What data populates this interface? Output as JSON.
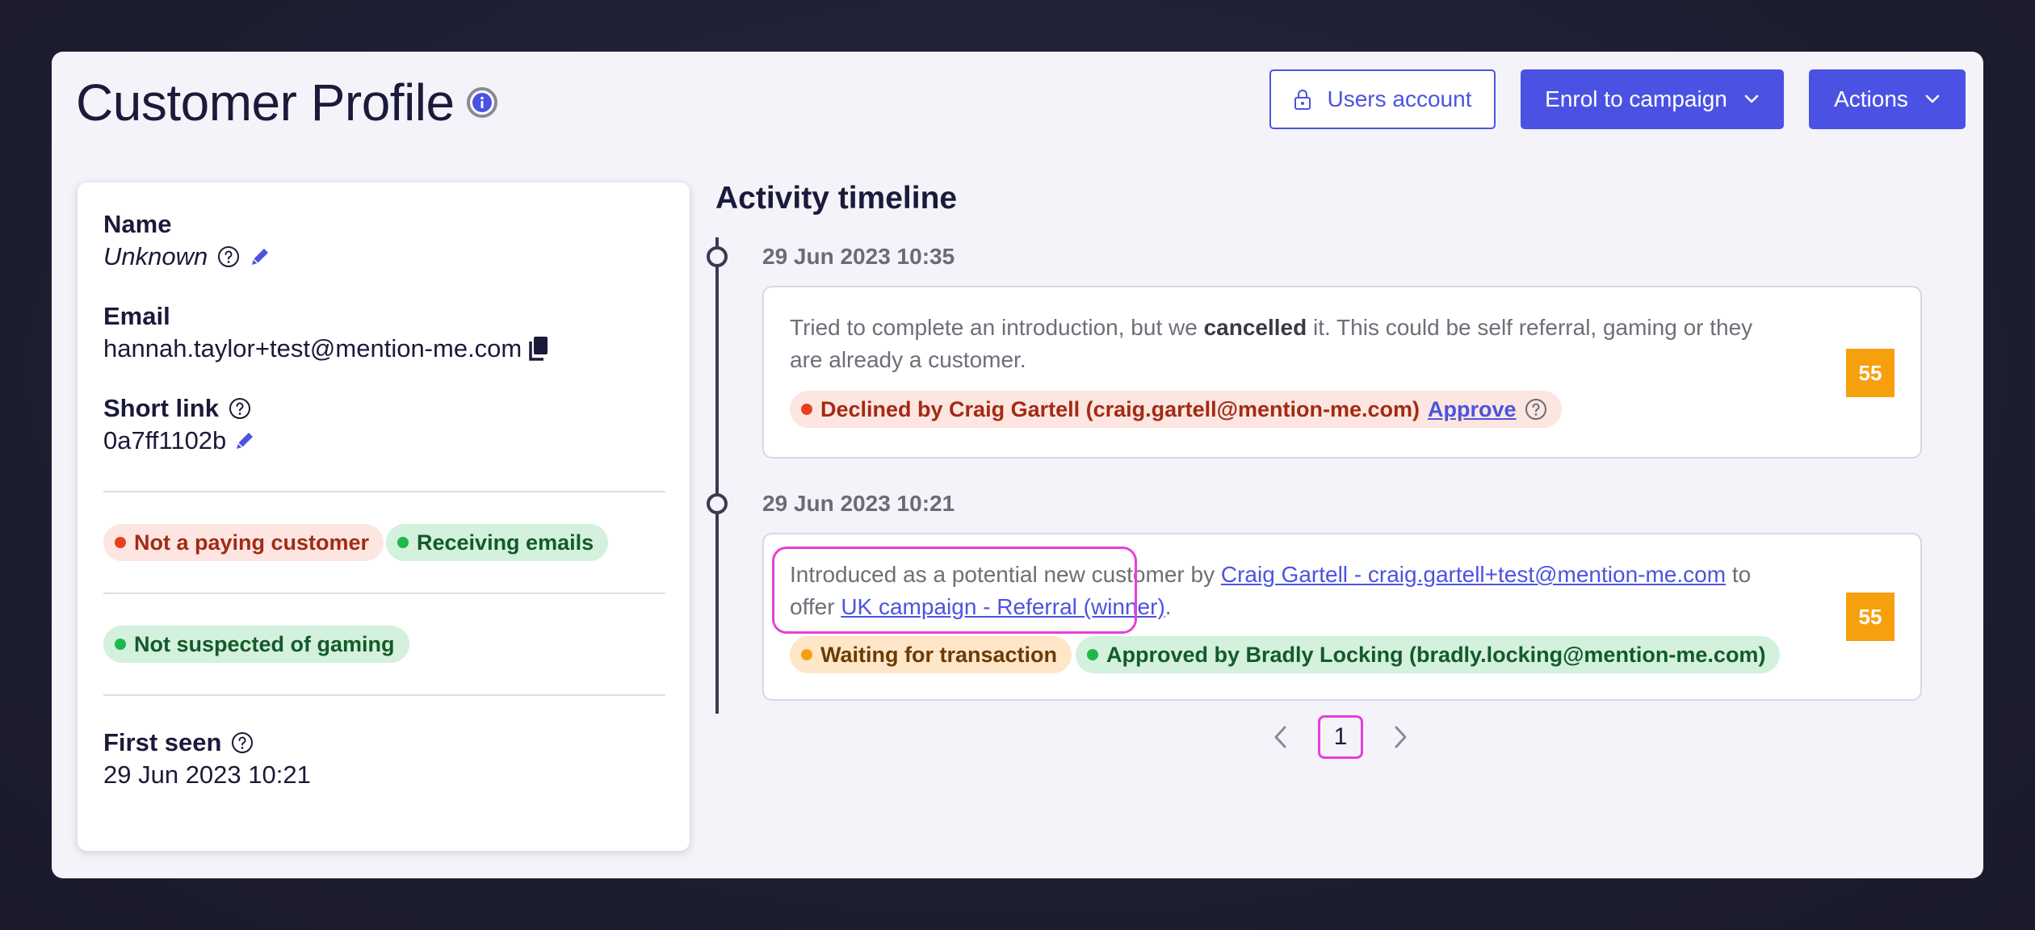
{
  "header": {
    "title": "Customer Profile",
    "users_account": "Users account",
    "enrol_campaign": "Enrol to campaign",
    "actions": "Actions"
  },
  "profile": {
    "name_label": "Name",
    "name_value": "Unknown",
    "email_label": "Email",
    "email_value": "hannah.taylor+test@mention-me.com",
    "short_link_label": "Short link",
    "short_link_value": "0a7ff1102b",
    "badges": {
      "paying": "Not a paying customer",
      "emails": "Receiving emails",
      "gaming": "Not suspected of gaming"
    },
    "first_seen_label": "First seen",
    "first_seen_value": "29 Jun 2023 10:21"
  },
  "timeline": {
    "title": "Activity timeline",
    "entries": [
      {
        "date": "29 Jun 2023 10:35",
        "text_pre": "Tried to complete an introduction, but we ",
        "text_bold": "cancelled",
        "text_post": " it. This could be self referral, gaming or they are already a customer.",
        "status": "Declined by Craig Gartell (craig.gartell@mention-me.com)",
        "action": "Approve",
        "score": "55"
      },
      {
        "date": "29 Jun 2023 10:21",
        "text_pre": "Introduced as a potential new customer by ",
        "referrer_link": "Craig Gartell - craig.gartell+test@mention-me.com",
        "text_mid": " to offer ",
        "campaign_link": "UK campaign - Referral (winner)",
        "text_post": ".",
        "status_waiting": "Waiting for transaction",
        "status_approved": "Approved by Bradly Locking (bradly.locking@mention-me.com)",
        "score": "55"
      }
    ]
  },
  "pagination": {
    "current": "1"
  },
  "colors": {
    "primary": "#4b52e3",
    "score": "#f7a00e",
    "danger_dot": "#e8401c",
    "success_dot": "#1fb84a",
    "warning_dot": "#f7a00e",
    "highlight": "#e640d6"
  }
}
